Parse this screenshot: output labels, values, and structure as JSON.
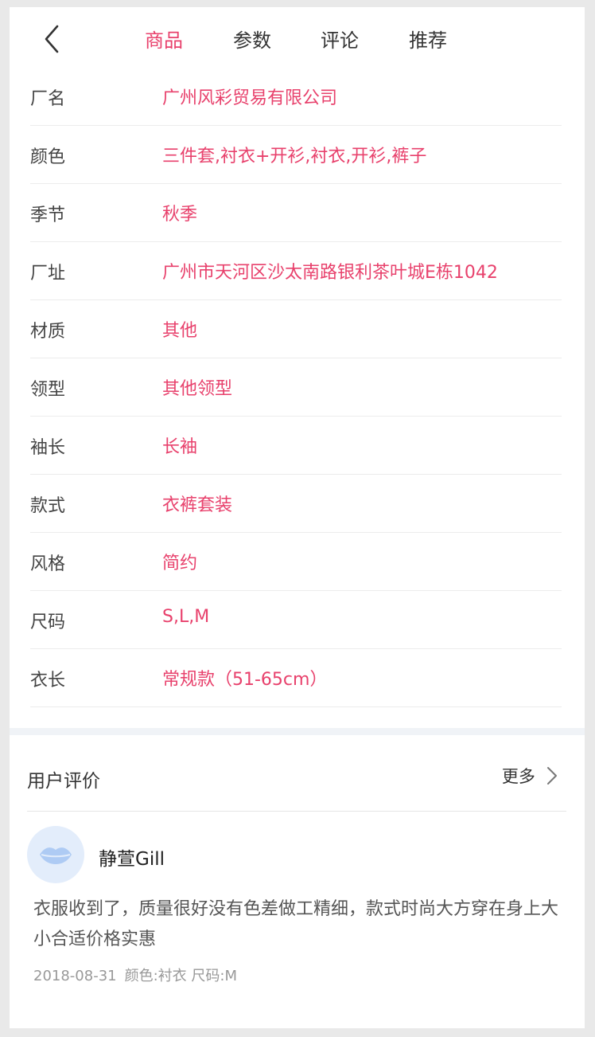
{
  "header": {
    "back_icon": "chevron-left-icon",
    "tabs": [
      {
        "label": "商品",
        "active": true
      },
      {
        "label": "参数",
        "active": false
      },
      {
        "label": "评论",
        "active": false
      },
      {
        "label": "推荐",
        "active": false
      }
    ]
  },
  "params": [
    {
      "key": "厂名",
      "value": "广州风彩贸易有限公司"
    },
    {
      "key": "颜色",
      "value": "三件套,衬衣+开衫,衬衣,开衫,裤子"
    },
    {
      "key": "季节",
      "value": "秋季"
    },
    {
      "key": "厂址",
      "value": "广州市天河区沙太南路银利茶叶城E栋1042"
    },
    {
      "key": "材质",
      "value": "其他"
    },
    {
      "key": "领型",
      "value": "其他领型"
    },
    {
      "key": "袖长",
      "value": "长袖"
    },
    {
      "key": "款式",
      "value": "衣裤套装"
    },
    {
      "key": "风格",
      "value": "简约"
    },
    {
      "key": "尺码",
      "value": "S,L,M"
    },
    {
      "key": "衣长",
      "value": "常规款（51-65cm）"
    }
  ],
  "reviews": {
    "title": "用户评价",
    "more_label": "更多",
    "items": [
      {
        "name": "静萱Gill",
        "avatar_icon": "lips-avatar-icon",
        "text": "衣服收到了，质量很好没有色差做工精细，款式时尚大方穿在身上大小合适价格实惠",
        "date": "2018-08-31",
        "spec": "颜色:衬衣 尺码:M"
      }
    ]
  },
  "colors": {
    "accent": "#e8416c",
    "text": "#333333",
    "muted": "#999999",
    "avatar_bg": "#e3edfb"
  }
}
